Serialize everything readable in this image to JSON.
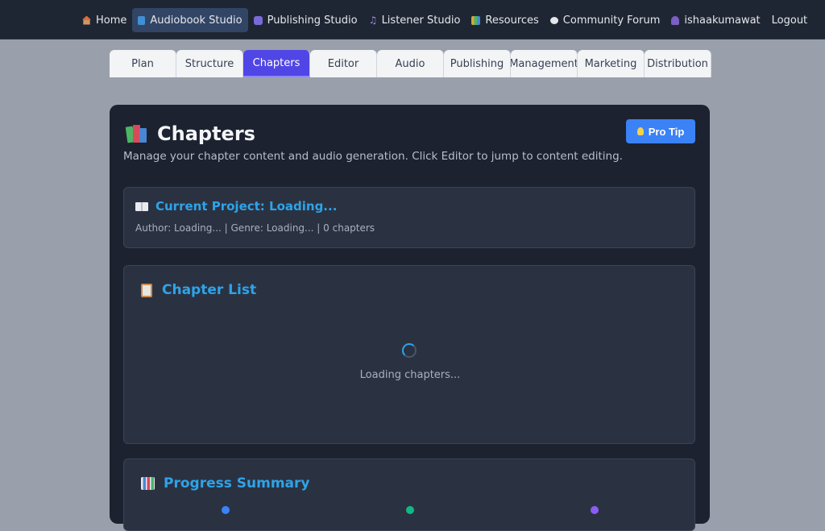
{
  "nav": {
    "items": [
      {
        "label": "Home",
        "icon": "home-icon"
      },
      {
        "label": "Audiobook Studio",
        "icon": "book-icon",
        "active": true
      },
      {
        "label": "Publishing Studio",
        "icon": "publishing-icon"
      },
      {
        "label": "Listener Studio",
        "icon": "music-note-icon"
      },
      {
        "label": "Resources",
        "icon": "books-icon"
      },
      {
        "label": "Community Forum",
        "icon": "chat-icon"
      },
      {
        "label": "ishaakumawat",
        "icon": "user-icon"
      },
      {
        "label": "Logout"
      }
    ]
  },
  "tabs": [
    "Plan",
    "Structure",
    "Chapters",
    "Editor",
    "Audio",
    "Publishing",
    "Management",
    "Marketing",
    "Distribution"
  ],
  "active_tab": "Chapters",
  "page": {
    "title": "Chapters",
    "subtitle": "Manage your chapter content and audio generation. Click Editor to jump to content editing.",
    "pro_tip_label": "Pro Tip"
  },
  "project": {
    "title": "Current Project: Loading...",
    "meta": "Author: Loading... | Genre: Loading... | 0 chapters"
  },
  "chapter_list": {
    "title": "Chapter List",
    "loading_text": "Loading chapters..."
  },
  "progress": {
    "title": "Progress Summary"
  },
  "colors": {
    "nav_bg": "#1f2633",
    "accent_tab": "#5046e5",
    "link_blue": "#2fa3e8",
    "button_blue": "#3b82f6",
    "panel_bg": "#1c2230",
    "card_bg": "#2a3242"
  }
}
